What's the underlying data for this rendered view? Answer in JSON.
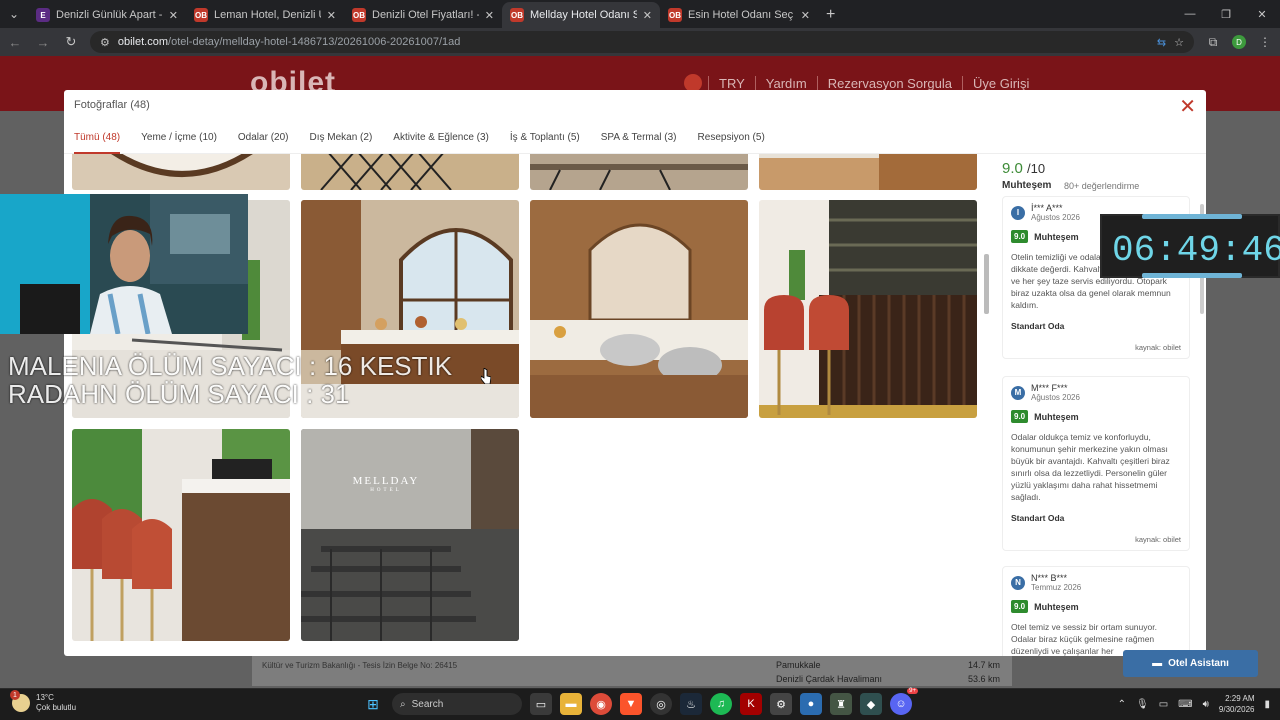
{
  "browser": {
    "tabs": [
      {
        "title": "Denizli Günlük Apart - Elite Res",
        "fav": "E",
        "fav_color": "#5b2c83"
      },
      {
        "title": "Leman Hotel, Denizli Ucuz Rezer",
        "fav": "OB",
        "fav_color": "#c0392b"
      },
      {
        "title": "Denizli Otel Fiyatları! - obilet.co",
        "fav": "OB",
        "fav_color": "#c0392b"
      },
      {
        "title": "Mellday Hotel Odanı Seç - obile",
        "fav": "OB",
        "fav_color": "#c0392b"
      },
      {
        "title": "Esin Hotel Odanı Seç - obilet.co",
        "fav": "OB",
        "fav_color": "#c0392b"
      }
    ],
    "active_tab": 3,
    "url_host": "obilet.com",
    "url_path": "/otel-detay/mellday-hotel-1486713/20261006-20261007/1ad",
    "profile_initial": "D"
  },
  "site": {
    "logo": "obilet",
    "nav": [
      "TRY",
      "Yardım",
      "Rezervasyon Sorgula",
      "Üye Girişi"
    ],
    "footer_left": "Kültür ve Turizm Bakanlığı - Tesis İzin Belge No: 26415",
    "footer_rows": [
      {
        "label": "Pamukkale",
        "value": "14.7 km"
      },
      {
        "label": "Denizli Çardak Havalimanı",
        "value": "53.6 km"
      }
    ],
    "assistant_label": "Otel Asistanı"
  },
  "modal": {
    "title": "Fotoğraflar (48)",
    "tabs": [
      "Tümü (48)",
      "Yeme / İçme (10)",
      "Odalar (20)",
      "Dış Mekan (2)",
      "Aktivite & Eğlence (3)",
      "İş & Toplantı (5)",
      "SPA & Termal (3)",
      "Resepsiyon (5)"
    ],
    "active_tab": 0,
    "photo_caption_sign": "MELLDAY",
    "photo_caption_sign_sub": "HOTEL"
  },
  "reviews": {
    "score": "9.0",
    "score_max": "/10",
    "label": "Muhteşem",
    "count": "80+ değerlendirme",
    "items": [
      {
        "initial": "I",
        "name": "İ*** A***",
        "date": "Ağustos 2026",
        "score": "9.0",
        "label": "Muhteşem",
        "text": "Otelin temizliği ve odaların düzeni gerçekten dikkate değerdi. Kahvaltıda çeşitler yeterliydi ve her şey taze servis ediliyordu. Otopark biraz uzakta olsa da genel olarak memnun kaldım.",
        "room": "Standart Oda",
        "source": "kaynak: obilet"
      },
      {
        "initial": "M",
        "name": "M*** F***",
        "date": "Ağustos 2026",
        "score": "9.0",
        "label": "Muhteşem",
        "text": "Odalar oldukça temiz ve konforluydu, konumunun şehir merkezine yakın olması büyük bir avantajdı. Kahvaltı çeşitleri biraz sınırlı olsa da lezzetliydi. Personelin güler yüzlü yaklaşımı daha rahat hissetmemi sağladı.",
        "room": "Standart Oda",
        "source": "kaynak: obilet"
      },
      {
        "initial": "N",
        "name": "N*** B***",
        "date": "Temmuz 2026",
        "score": "9.0",
        "label": "Muhteşem",
        "text": "Otel temiz ve sessiz bir ortam sunuyor. Odalar biraz küçük gelmesine rağmen düzenliydi ve çalışanlar her",
        "room": "",
        "source": ""
      }
    ]
  },
  "overlay": {
    "line1": "MALENIA ÖLÜM SAYACI : 16 KESTIK",
    "line2": "RADAHN ÖLÜM SAYACI : 31",
    "clock": "06:49:46"
  },
  "taskbar": {
    "temp": "13°C",
    "weather": "Çok bulutlu",
    "search_placeholder": "Search",
    "time": "2:29 AM",
    "date": "9/30/2026",
    "notif_badge": "1",
    "discord_badge": "9+"
  },
  "colors": {
    "brand": "#c0392b",
    "score_green": "#2e8b2e",
    "assist_blue": "#3a6ea5",
    "clock_cyan": "#6fd6e8"
  }
}
